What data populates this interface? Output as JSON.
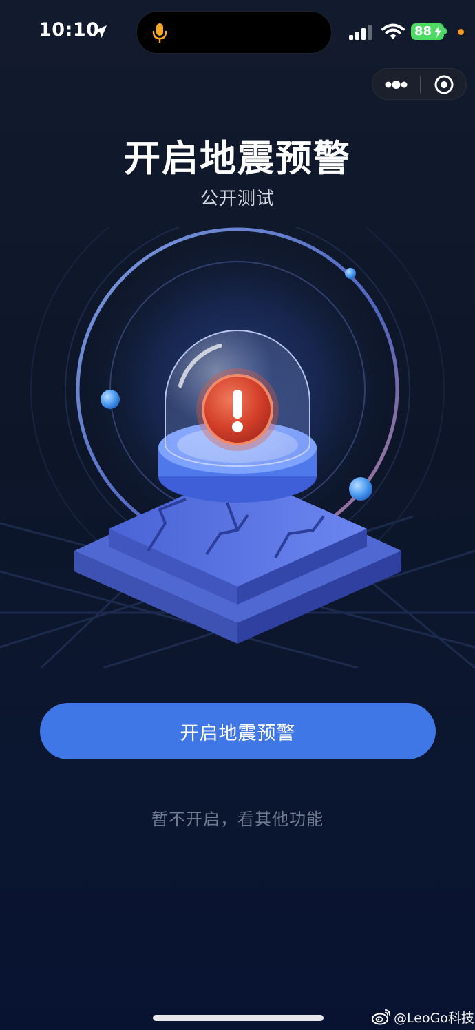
{
  "status_bar": {
    "time": "10:10",
    "battery": "88"
  },
  "page": {
    "title": "开启地震预警",
    "subtitle": "公开测试"
  },
  "actions": {
    "enable_label": "开启地震预警",
    "skip_label": "暂不开启，看其他功能"
  },
  "watermark": {
    "text": "@LeoGo科技"
  },
  "colors": {
    "background": "#0b1426",
    "primary_button": "#3f77e6",
    "alert_red": "#e0452f",
    "platform_blue": "#4a6fe0",
    "battery_green": "#4cd964",
    "privacy_dot": "#f59a23"
  },
  "icons": [
    "location-arrow-icon",
    "microphone-icon",
    "cellular-signal-icon",
    "wifi-icon",
    "charging-bolt-icon",
    "more-dots-icon",
    "close-target-icon",
    "exclamation-alert-icon",
    "weibo-logo-icon"
  ]
}
